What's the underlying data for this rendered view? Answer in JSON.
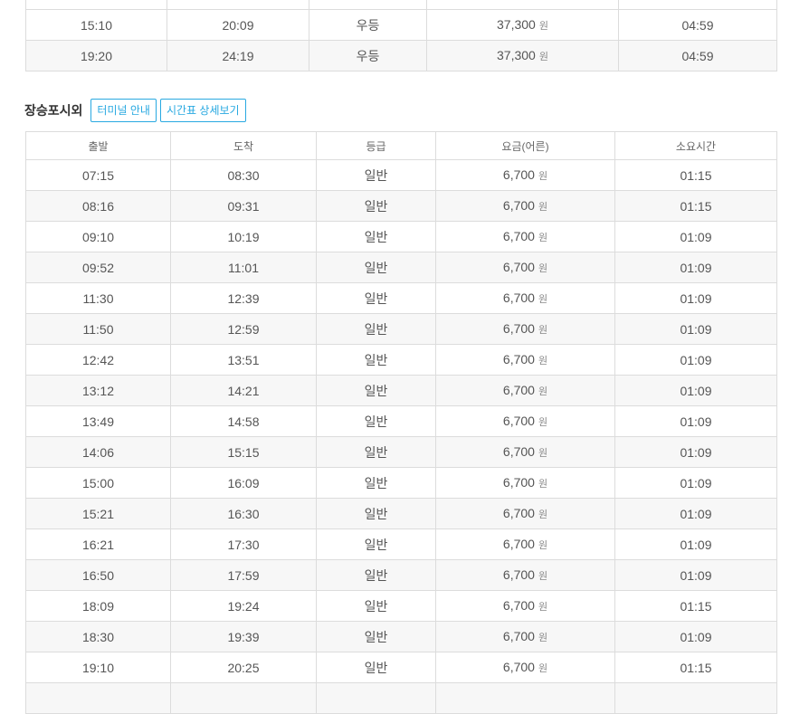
{
  "top_table": {
    "rows": [
      {
        "dep": "",
        "arr": "",
        "grade": "",
        "fare": "",
        "currency": "",
        "duration": ""
      },
      {
        "dep": "15:10",
        "arr": "20:09",
        "grade": "우등",
        "fare": "37,300",
        "currency": "원",
        "duration": "04:59"
      },
      {
        "dep": "19:20",
        "arr": "24:19",
        "grade": "우등",
        "fare": "37,300",
        "currency": "원",
        "duration": "04:59"
      }
    ]
  },
  "section": {
    "title": "장승포시외",
    "terminal_button": "터미널 안내",
    "schedule_button": "시간표 상세보기"
  },
  "table": {
    "headers": [
      "출발",
      "도착",
      "등급",
      "요금(어른)",
      "소요시간"
    ],
    "rows": [
      {
        "dep": "07:15",
        "arr": "08:30",
        "grade": "일반",
        "fare": "6,700",
        "currency": "원",
        "duration": "01:15"
      },
      {
        "dep": "08:16",
        "arr": "09:31",
        "grade": "일반",
        "fare": "6,700",
        "currency": "원",
        "duration": "01:15"
      },
      {
        "dep": "09:10",
        "arr": "10:19",
        "grade": "일반",
        "fare": "6,700",
        "currency": "원",
        "duration": "01:09"
      },
      {
        "dep": "09:52",
        "arr": "11:01",
        "grade": "일반",
        "fare": "6,700",
        "currency": "원",
        "duration": "01:09"
      },
      {
        "dep": "11:30",
        "arr": "12:39",
        "grade": "일반",
        "fare": "6,700",
        "currency": "원",
        "duration": "01:09"
      },
      {
        "dep": "11:50",
        "arr": "12:59",
        "grade": "일반",
        "fare": "6,700",
        "currency": "원",
        "duration": "01:09"
      },
      {
        "dep": "12:42",
        "arr": "13:51",
        "grade": "일반",
        "fare": "6,700",
        "currency": "원",
        "duration": "01:09"
      },
      {
        "dep": "13:12",
        "arr": "14:21",
        "grade": "일반",
        "fare": "6,700",
        "currency": "원",
        "duration": "01:09"
      },
      {
        "dep": "13:49",
        "arr": "14:58",
        "grade": "일반",
        "fare": "6,700",
        "currency": "원",
        "duration": "01:09"
      },
      {
        "dep": "14:06",
        "arr": "15:15",
        "grade": "일반",
        "fare": "6,700",
        "currency": "원",
        "duration": "01:09"
      },
      {
        "dep": "15:00",
        "arr": "16:09",
        "grade": "일반",
        "fare": "6,700",
        "currency": "원",
        "duration": "01:09"
      },
      {
        "dep": "15:21",
        "arr": "16:30",
        "grade": "일반",
        "fare": "6,700",
        "currency": "원",
        "duration": "01:09"
      },
      {
        "dep": "16:21",
        "arr": "17:30",
        "grade": "일반",
        "fare": "6,700",
        "currency": "원",
        "duration": "01:09"
      },
      {
        "dep": "16:50",
        "arr": "17:59",
        "grade": "일반",
        "fare": "6,700",
        "currency": "원",
        "duration": "01:09"
      },
      {
        "dep": "18:09",
        "arr": "19:24",
        "grade": "일반",
        "fare": "6,700",
        "currency": "원",
        "duration": "01:15"
      },
      {
        "dep": "18:30",
        "arr": "19:39",
        "grade": "일반",
        "fare": "6,700",
        "currency": "원",
        "duration": "01:09"
      },
      {
        "dep": "19:10",
        "arr": "20:25",
        "grade": "일반",
        "fare": "6,700",
        "currency": "원",
        "duration": "01:15"
      },
      {
        "dep": "",
        "arr": "",
        "grade": "",
        "fare": "",
        "currency": "",
        "duration": ""
      }
    ]
  },
  "colors": {
    "accent": "#29a9e1",
    "border": "#dcdcdc",
    "row_alt": "#f7f7f7",
    "text": "#555555"
  }
}
